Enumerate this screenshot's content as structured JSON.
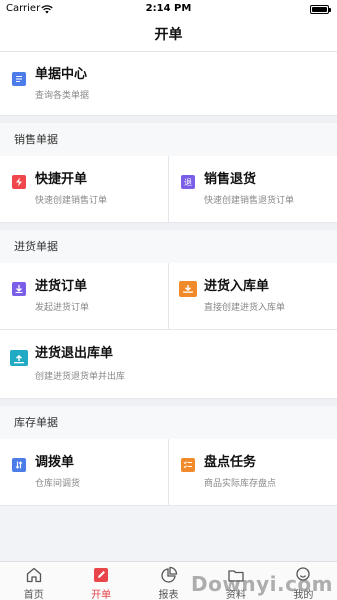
{
  "status_bar": {
    "carrier": "Carrier",
    "time": "2:14 PM",
    "battery_level": 1.0
  },
  "nav": {
    "title": "开单"
  },
  "bill_center": {
    "title": "单据中心",
    "subtitle": "查询各类单据",
    "icon": "document-icon",
    "color": "#4b7ce8"
  },
  "sections": [
    {
      "title": "销售单据",
      "items": [
        {
          "title": "快捷开单",
          "subtitle": "快速创建销售订单",
          "icon": "lightning-icon",
          "color": "#f0474d"
        },
        {
          "title": "销售退货",
          "subtitle": "快速创建销售退货订单",
          "icon": "return-icon",
          "color": "#7a5ee8",
          "glyph": "退"
        }
      ]
    },
    {
      "title": "进货单据",
      "items": [
        {
          "title": "进货订单",
          "subtitle": "发起进货订单",
          "icon": "download-icon",
          "color": "#7a5ee8"
        },
        {
          "title": "进货入库单",
          "subtitle": "直接创建进货入库单",
          "icon": "inbound-box-icon",
          "color": "#f08a2a"
        },
        {
          "title": "进货退出库单",
          "subtitle": "创建进货退货单并出库",
          "icon": "outbound-box-icon",
          "color": "#22a9c4"
        }
      ]
    },
    {
      "title": "库存单据",
      "items": [
        {
          "title": "调拨单",
          "subtitle": "仓库间调货",
          "icon": "transfer-icon",
          "color": "#4b7ce8"
        },
        {
          "title": "盘点任务",
          "subtitle": "商品实际库存盘点",
          "icon": "checklist-icon",
          "color": "#f08a2a"
        }
      ]
    }
  ],
  "tabs": [
    {
      "label": "首页",
      "icon": "home-icon",
      "active": false
    },
    {
      "label": "开单",
      "icon": "edit-icon",
      "active": true
    },
    {
      "label": "报表",
      "icon": "pie-chart-icon",
      "active": false
    },
    {
      "label": "资料",
      "icon": "folder-icon",
      "active": false
    },
    {
      "label": "我的",
      "icon": "user-icon",
      "active": false
    }
  ],
  "watermark": "Downyi.com",
  "colors": {
    "accent": "#e8444a",
    "background": "#f2f3f7"
  }
}
